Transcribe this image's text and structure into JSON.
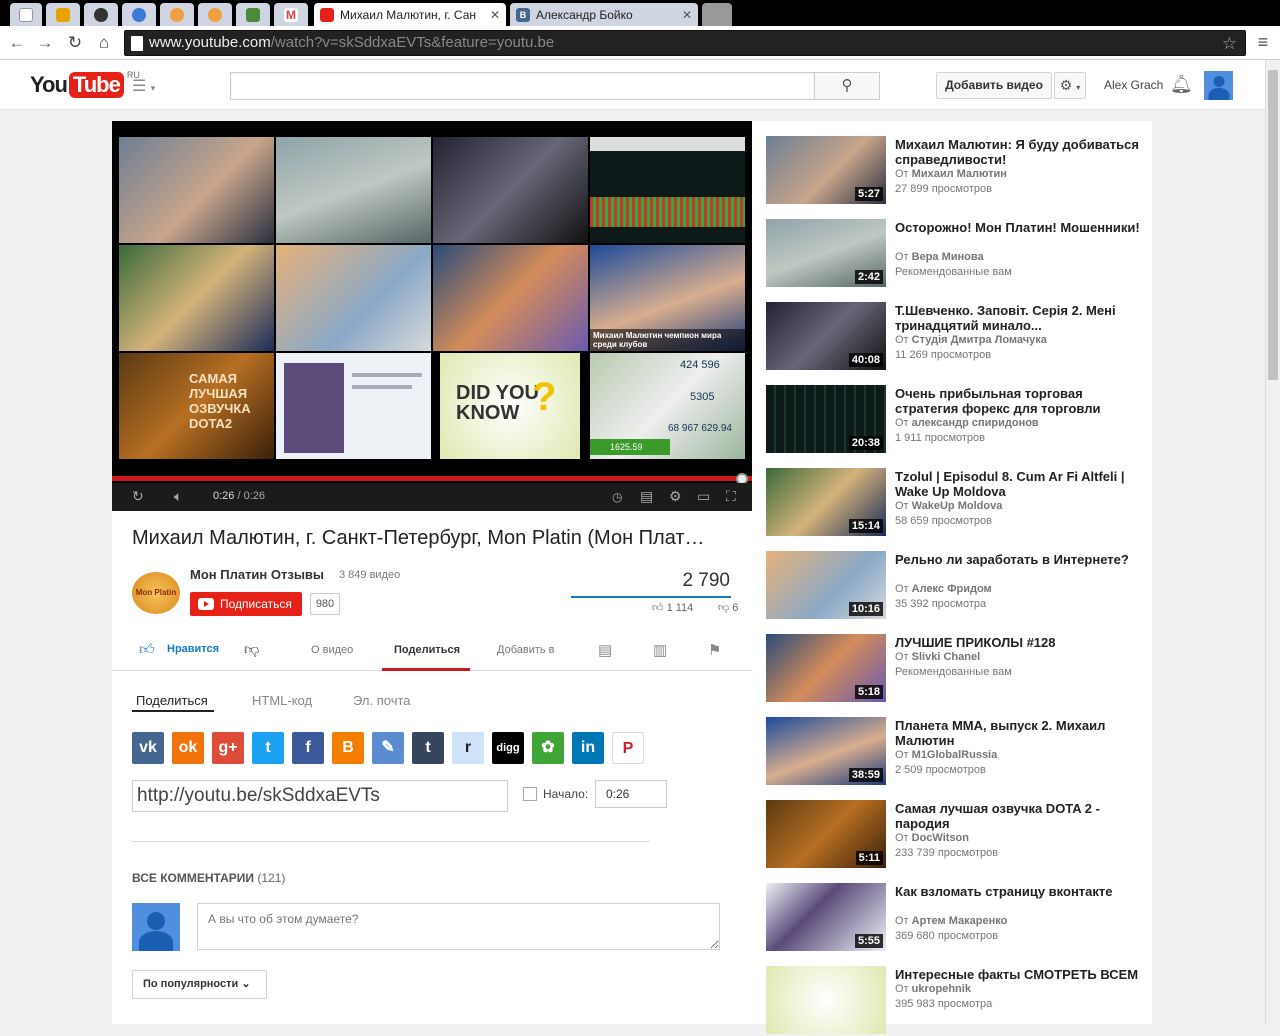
{
  "browser": {
    "tabs": [
      {
        "label": ""
      },
      {
        "label": ""
      },
      {
        "label": ""
      },
      {
        "label": ""
      },
      {
        "label": ""
      },
      {
        "label": ""
      },
      {
        "label": ""
      },
      {
        "label": ""
      },
      {
        "label": "Михаил Малютин, г. Сан"
      },
      {
        "label": "Александр Бойко"
      }
    ],
    "address": {
      "host": "www.youtube.com",
      "path": "/watch?v=skSddxaEVTs&feature=youtu.be"
    }
  },
  "header": {
    "logo_you": "You",
    "logo_tube": "Tube",
    "logo_region": "RU",
    "search_placeholder": "",
    "upload_label": "Добавить видео",
    "user_name": "Alex Grach"
  },
  "player": {
    "current_time": "0:26",
    "separator": " / ",
    "duration": "0:26",
    "progress_fraction": 1.0,
    "thumb_caption_mma": "Михаил Малютин чемпион мира среди клубов",
    "thumb_dota": "САМАЯ ЛУЧШАЯ ОЗВУЧКА DOTA2",
    "thumb_didyouknow": "DID YOU KNOW",
    "thumb_money_1": "424 596",
    "thumb_money_2": "5305",
    "thumb_money_3": "68 967 629.94",
    "thumb_money_4": "1625.59"
  },
  "video": {
    "title": "Михаил Малютин, г. Санкт-Петербург, Mon Platin (Мон Плат…",
    "channel_name": "Мон Платин Отзывы",
    "channel_videos": "3 849 видео",
    "channel_logo_text": "Mon Platin",
    "subscribe_label": "Подписаться",
    "subscriber_count": "980",
    "views": "2 790",
    "likes": "1 114",
    "dislikes": "6"
  },
  "actions": {
    "like_label": "Нравится",
    "about_label": "О видео",
    "share_label": "Поделиться",
    "add_label": "Добавить в"
  },
  "share": {
    "tab_share": "Поделиться",
    "tab_embed": "HTML-код",
    "tab_email": "Эл. почта",
    "url": "http://youtu.be/skSddxaEVTs",
    "start_label": "Начало:",
    "start_time": "0:26",
    "services": [
      {
        "name": "vk",
        "glyph": "vk",
        "color": "#45668e"
      },
      {
        "name": "odnoklassniki",
        "glyph": "ok",
        "color": "#f2720c"
      },
      {
        "name": "google-plus",
        "glyph": "g+",
        "color": "#dd4b39"
      },
      {
        "name": "twitter",
        "glyph": "t",
        "color": "#1da1f2"
      },
      {
        "name": "facebook",
        "glyph": "f",
        "color": "#3b5998"
      },
      {
        "name": "blogger",
        "glyph": "B",
        "color": "#f57d00"
      },
      {
        "name": "livejournal",
        "glyph": "✎",
        "color": "#5b8cd0"
      },
      {
        "name": "tumblr",
        "glyph": "t",
        "color": "#35465c"
      },
      {
        "name": "reddit",
        "glyph": "r",
        "color": "#cee3f8"
      },
      {
        "name": "digg",
        "glyph": "digg",
        "color": "#000000"
      },
      {
        "name": "mailru",
        "glyph": "✿",
        "color": "#3fa535"
      },
      {
        "name": "linkedin",
        "glyph": "in",
        "color": "#0077b5"
      },
      {
        "name": "pinterest",
        "glyph": "P",
        "color": "#ffffff"
      }
    ]
  },
  "comments": {
    "heading": "ВСЕ КОММЕНТАРИИ",
    "count": "(121)",
    "placeholder": "А вы что об этом думаете?",
    "sort_label": "По популярности"
  },
  "related": [
    {
      "title": "Михаил Малютин: Я буду добиваться справедливости!",
      "by_prefix": "От ",
      "channel": "Михаил Малютин",
      "meta": "27 899 просмотров",
      "duration": "5:27"
    },
    {
      "title": "Осторожно! Мон Платин! Мошенники!",
      "by_prefix": "От ",
      "channel": "Вера Минова",
      "meta": "Рекомендованные вам",
      "duration": "2:42"
    },
    {
      "title": "Т.Шевченко. Заповіт. Серія 2. Мені тринадцятий минало...",
      "by_prefix": "От ",
      "channel": "Студія Дмитра Ломачука",
      "meta": "11 269 просмотров",
      "duration": "40:08"
    },
    {
      "title": "Очень прибыльная торговая стратегия форекс для торговли",
      "by_prefix": "От ",
      "channel": "александр спиридонов",
      "meta": "1 911 просмотров",
      "duration": "20:38"
    },
    {
      "title": "Tzolul | Episodul 8. Cum Ar Fi Altfeli | Wake Up Moldova",
      "by_prefix": "От ",
      "channel": "WakeUp Moldova",
      "meta": "58 659 просмотров",
      "duration": "15:14"
    },
    {
      "title": "Рельно ли заработать в Интернете?",
      "by_prefix": "От ",
      "channel": "Алекс Фридом",
      "meta": "35 392 просмотра",
      "duration": "10:16"
    },
    {
      "title": "ЛУЧШИЕ ПРИКОЛЫ #128",
      "by_prefix": "От ",
      "channel": "Slivki Chanel",
      "meta": "Рекомендованные вам",
      "duration": "5:18"
    },
    {
      "title": "Планета ММА, выпуск 2. Михаил Малютин",
      "by_prefix": "От ",
      "channel": "M1GlobalRussia",
      "meta": "2 509 просмотров",
      "duration": "38:59"
    },
    {
      "title": "Самая лучшая озвучка DOTA 2 - пародия",
      "by_prefix": "От ",
      "channel": "DocWitson",
      "meta": "233 739 просмотров",
      "duration": "5:11"
    },
    {
      "title": "Как взломать страницу вконтакте",
      "by_prefix": "От ",
      "channel": "Артем Макаренко",
      "meta": "369 680 просмотров",
      "duration": "5:55"
    },
    {
      "title": "Интересные факты СМОТРЕТЬ ВСЕМ",
      "by_prefix": "От ",
      "channel": "ukropehnik",
      "meta": "395 983 просмотра",
      "duration": ""
    }
  ]
}
